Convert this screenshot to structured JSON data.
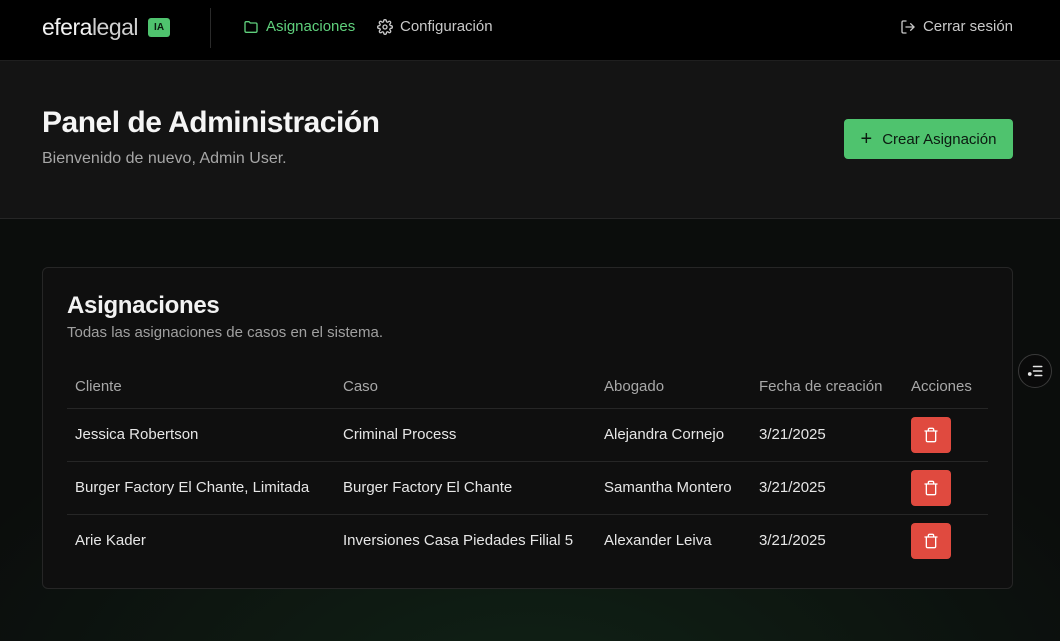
{
  "brand": {
    "name_bold": "efera",
    "name_light": "legal",
    "badge": "IA"
  },
  "nav": {
    "items": [
      {
        "label": "Asignaciones",
        "icon": "folder-icon",
        "active": true
      },
      {
        "label": "Configuración",
        "icon": "gear-icon",
        "active": false
      }
    ],
    "logout_label": "Cerrar sesión"
  },
  "header": {
    "title": "Panel de Administración",
    "subtitle": "Bienvenido de nuevo, Admin User.",
    "create_button_label": "Crear Asignación"
  },
  "assignments": {
    "title": "Asignaciones",
    "subtitle": "Todas las asignaciones de casos en el sistema.",
    "columns": [
      "Cliente",
      "Caso",
      "Abogado",
      "Fecha de creación",
      "Acciones"
    ],
    "rows": [
      {
        "client": "Jessica Robertson",
        "case": "Criminal Process",
        "lawyer": "Alejandra Cornejo",
        "date": "3/21/2025"
      },
      {
        "client": "Burger Factory El Chante, Limitada",
        "case": "Burger Factory El Chante",
        "lawyer": "Samantha Montero",
        "date": "3/21/2025"
      },
      {
        "client": "Arie Kader",
        "case": "Inversiones Casa Piedades Filial 5",
        "lawyer": "Alexander Leiva",
        "date": "3/21/2025"
      }
    ]
  },
  "colors": {
    "accent": "#4fc36e",
    "danger": "#e04a3f",
    "background": "#0b0d0c"
  }
}
